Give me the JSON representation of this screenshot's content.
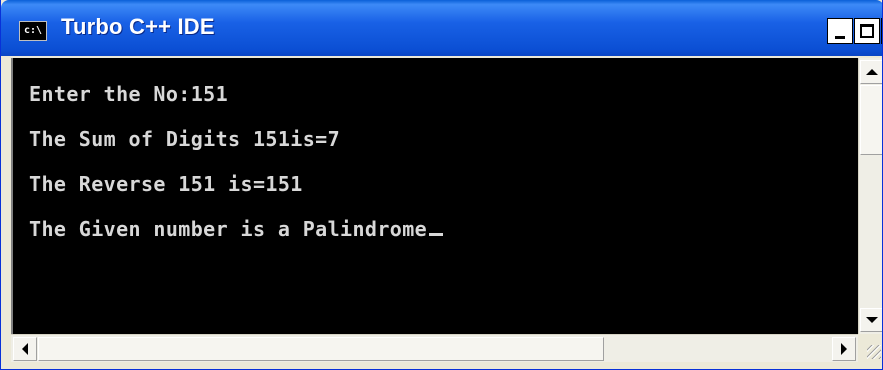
{
  "window": {
    "title": "Turbo C++ IDE",
    "icon": "console-icon",
    "icon_glyph": "c:\\"
  },
  "titlebar": {
    "minimize_icon": "minimize-icon",
    "maximize_icon": "maximize-icon",
    "close_icon": "close-icon",
    "close_glyph": "×"
  },
  "console": {
    "lines": [
      "Enter the No:151",
      "The Sum of Digits 151is=7",
      "The Reverse 151 is=151",
      "The Given number is a Palindrome"
    ],
    "text_color": "#d8d8d8",
    "background": "#000000"
  },
  "scrollbars": {
    "vertical": {
      "up_icon": "scroll-up-arrow-icon",
      "down_icon": "scroll-down-arrow-icon"
    },
    "horizontal": {
      "left_icon": "scroll-left-arrow-icon",
      "right_icon": "scroll-right-arrow-icon"
    }
  },
  "colors": {
    "titlebar_blue": "#0b4fd4",
    "window_frame": "#ece9d8"
  }
}
